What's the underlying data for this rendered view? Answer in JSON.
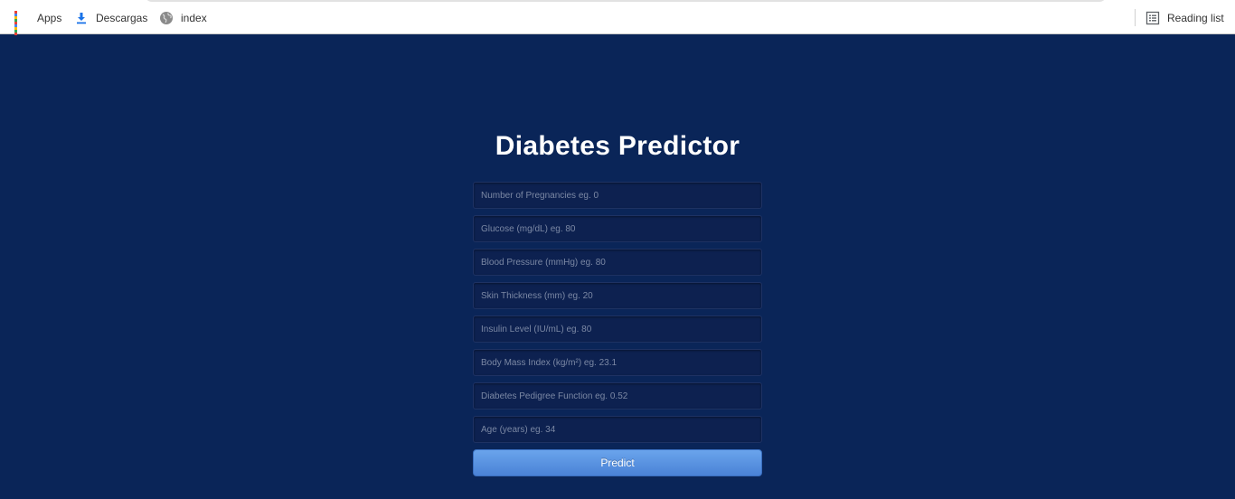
{
  "bookmarks_bar": {
    "items": [
      {
        "label": "Apps",
        "icon": "apps-grid-icon"
      },
      {
        "label": "Descargas",
        "icon": "download-icon"
      },
      {
        "label": "index",
        "icon": "globe-icon"
      }
    ],
    "reading_list": {
      "label": "Reading list",
      "icon": "reading-list-icon"
    }
  },
  "page": {
    "title": "Diabetes Predictor"
  },
  "form": {
    "fields": [
      {
        "placeholder": "Number of Pregnancies eg. 0",
        "value": ""
      },
      {
        "placeholder": "Glucose (mg/dL) eg. 80",
        "value": ""
      },
      {
        "placeholder": "Blood Pressure (mmHg) eg. 80",
        "value": ""
      },
      {
        "placeholder": "Skin Thickness (mm) eg. 20",
        "value": ""
      },
      {
        "placeholder": "Insulin Level (IU/mL) eg. 80",
        "value": ""
      },
      {
        "placeholder": "Body Mass Index (kg/m²) eg. 23.1",
        "value": ""
      },
      {
        "placeholder": "Diabetes Pedigree Function eg. 0.52",
        "value": ""
      },
      {
        "placeholder": "Age (years) eg. 34",
        "value": ""
      }
    ],
    "submit_label": "Predict"
  },
  "colors": {
    "page_background": "#0a2558",
    "field_background": "#0d2150",
    "button_accent": "#5a93e1",
    "bookmarks_background": "#ffffff"
  }
}
